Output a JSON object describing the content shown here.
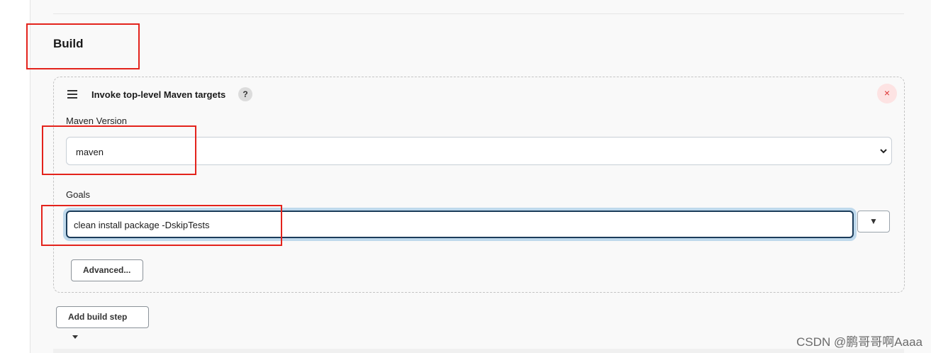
{
  "section": {
    "title": "Build"
  },
  "build_step": {
    "title": "Invoke top-level Maven targets",
    "help_symbol": "?",
    "delete_symbol": "×",
    "maven_version": {
      "label": "Maven Version",
      "selected": "maven"
    },
    "goals": {
      "label": "Goals",
      "value": "clean install package -DskipTests",
      "expand_symbol": "▼"
    },
    "advanced_label": "Advanced..."
  },
  "add_build_step_label": "Add build step",
  "watermark": "CSDN @鹏哥哥啊Aaaa",
  "colors": {
    "annotation": "#e3231c",
    "focus_ring": "#bfd9ec",
    "delete_bg": "#fde3e3"
  }
}
